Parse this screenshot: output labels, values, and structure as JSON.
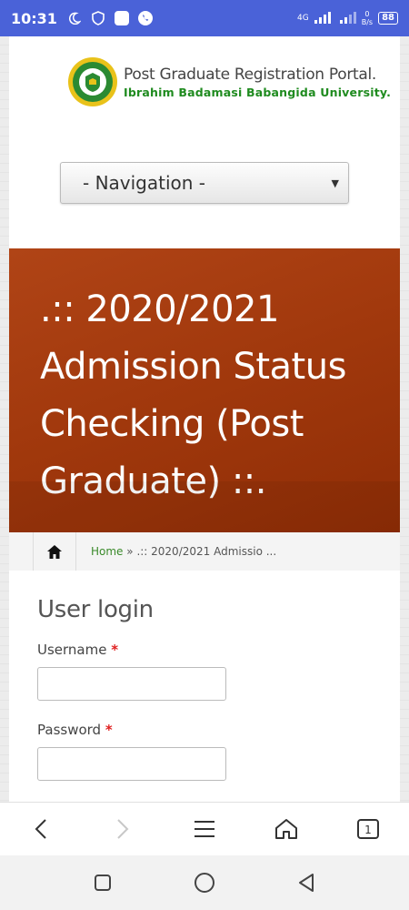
{
  "status_bar": {
    "time": "10:31",
    "network": "4G",
    "speed_value": "0",
    "speed_unit": "B/s",
    "battery": "88"
  },
  "header": {
    "portal_title": "Post Graduate Registration Portal.",
    "university": "Ibrahim Badamasi Babangida University.",
    "logo_icon": "university-crest"
  },
  "navigation": {
    "selected": "- Navigation -"
  },
  "banner": {
    "title": ".:: 2020/2021 Admission Status Checking (Post Graduate) ::."
  },
  "breadcrumb": {
    "home": "Home",
    "separator": "»",
    "current": ".:: 2020/2021 Admissio ..."
  },
  "login": {
    "heading": "User login",
    "username_label": "Username",
    "password_label": "Password",
    "required_mark": "*"
  },
  "colors": {
    "status_bar": "#4a62d8",
    "banner": "#a2390d",
    "link_green": "#3a8a2a",
    "required_red": "#e02020"
  },
  "browser_toolbar": {
    "tab_count": "1",
    "icons": [
      "back-icon",
      "forward-icon",
      "menu-icon",
      "home-icon",
      "tabs-icon"
    ]
  },
  "system_nav": {
    "icons": [
      "recents-icon",
      "home-circle-icon",
      "back-triangle-icon"
    ]
  }
}
